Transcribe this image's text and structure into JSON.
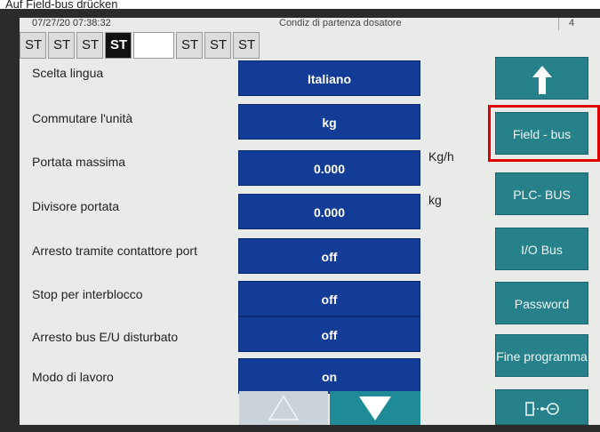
{
  "caption": {
    "text_before": "Auf ",
    "link": "Field-bus",
    "text_after": " drücken"
  },
  "header": {
    "datetime": "07/27/20 07:38:32",
    "title": "Condiz di partenza dosatore",
    "right": "4"
  },
  "tabs": [
    {
      "label": "ST",
      "state": "normal"
    },
    {
      "label": "ST",
      "state": "normal"
    },
    {
      "label": "ST",
      "state": "normal"
    },
    {
      "label": "ST",
      "state": "active"
    },
    {
      "label": "",
      "state": "blank"
    },
    {
      "label": "ST",
      "state": "normal"
    },
    {
      "label": "ST",
      "state": "normal"
    },
    {
      "label": "ST",
      "state": "normal"
    }
  ],
  "rows": [
    {
      "label": "Scelta lingua",
      "value": "Italiano",
      "unit": ""
    },
    {
      "label": "Commutare l'unità",
      "value": "kg",
      "unit": ""
    },
    {
      "label": "Portata massima",
      "value": "0.000",
      "unit": "Kg/h"
    },
    {
      "label": "Divisore portata",
      "value": "0.000",
      "unit": "kg"
    },
    {
      "label": "Arresto tramite contattore port",
      "value": "off",
      "unit": ""
    },
    {
      "label": "Stop per interblocco",
      "value": "off",
      "unit": ""
    },
    {
      "label": "Arresto bus E/U disturbato",
      "value": "off",
      "unit": ""
    },
    {
      "label": "Modo di lavoro",
      "value": "on",
      "unit": ""
    }
  ],
  "side_buttons": {
    "up_icon": "arrow-up-icon",
    "field_bus": "Field - bus",
    "plc_bus": "PLC- BUS",
    "io_bus": "I/O Bus",
    "password": "Password",
    "end_program": "Fine programma",
    "connection_icon": "connection-icon"
  },
  "colors": {
    "value_field": "#123c95",
    "side_button": "#26818a",
    "highlight": "#e00000",
    "nav_down": "#1f8b96",
    "nav_up": "#c9d3d9"
  }
}
